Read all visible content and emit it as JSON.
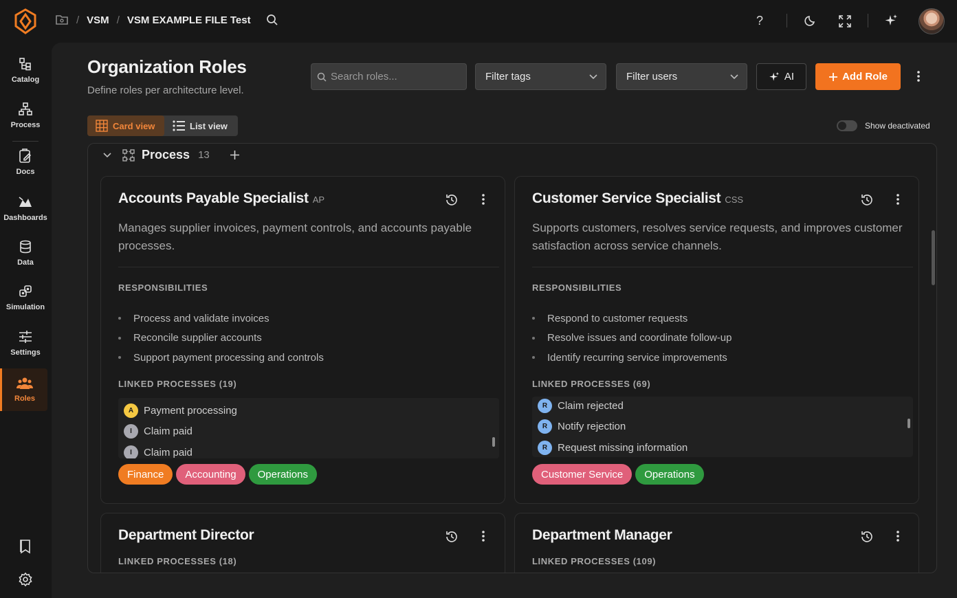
{
  "app": {
    "breadcrumb": [
      "VSM",
      "VSM EXAMPLE FILE Test"
    ],
    "help_label": "?"
  },
  "sidebar": {
    "items": [
      {
        "label": "Catalog",
        "icon": "catalog-icon"
      },
      {
        "label": "Process",
        "icon": "process-icon"
      },
      {
        "label": "Docs",
        "icon": "docs-icon"
      },
      {
        "label": "Dashboards",
        "icon": "dashboards-icon"
      },
      {
        "label": "Data",
        "icon": "database-icon"
      },
      {
        "label": "Simulation",
        "icon": "simulation-icon"
      },
      {
        "label": "Settings",
        "icon": "sliders-icon"
      },
      {
        "label": "Roles",
        "icon": "users-icon",
        "active": true
      }
    ]
  },
  "page": {
    "title": "Organization Roles",
    "subtitle": "Define roles per architecture level.",
    "search_placeholder": "Search roles...",
    "filter_tags": "Filter tags",
    "filter_users": "Filter users",
    "ai_label": "AI",
    "add_role_label": "Add Role",
    "card_view_label": "Card view",
    "list_view_label": "List view",
    "show_deactivated_label": "Show deactivated",
    "show_deactivated": false
  },
  "group": {
    "title": "Process",
    "count": "13"
  },
  "sections": {
    "responsibilities": "RESPONSIBILITIES"
  },
  "cards": [
    {
      "title": "Accounts Payable Specialist",
      "abbr": "AP",
      "description": "Manages supplier invoices, payment controls, and accounts payable processes.",
      "responsibilities": [
        "Process and validate invoices",
        "Reconcile supplier accounts",
        "Support payment processing and controls"
      ],
      "linked_label": "LINKED PROCESSES (19)",
      "linked": [
        {
          "badge": "A",
          "name": "Payment processing"
        },
        {
          "badge": "I",
          "name": "Claim paid"
        },
        {
          "badge": "I",
          "name": "Claim paid"
        }
      ],
      "tags": [
        {
          "label": "Finance",
          "color": "#f07c22"
        },
        {
          "label": "Accounting",
          "color": "#e0607a"
        },
        {
          "label": "Operations",
          "color": "#2f9a3f"
        }
      ]
    },
    {
      "title": "Customer Service Specialist",
      "abbr": "CSS",
      "description": "Supports customers, resolves service requests, and improves customer satisfaction across service channels.",
      "responsibilities": [
        "Respond to customer requests",
        "Resolve issues and coordinate follow-up",
        "Identify recurring service improvements"
      ],
      "linked_label": "LINKED PROCESSES (69)",
      "linked": [
        {
          "badge": "R",
          "name": "Claim rejected"
        },
        {
          "badge": "R",
          "name": "Notify rejection"
        },
        {
          "badge": "R",
          "name": "Request missing information"
        }
      ],
      "tags": [
        {
          "label": "Customer Service",
          "color": "#e0607a"
        },
        {
          "label": "Operations",
          "color": "#2f9a3f"
        }
      ]
    },
    {
      "title": "Department Director",
      "linked_label": "LINKED PROCESSES (18)"
    },
    {
      "title": "Department Manager",
      "linked_label": "LINKED PROCESSES (109)"
    }
  ],
  "colors": {
    "accent": "#f2731f",
    "badge_A": "#f5c842",
    "badge_I": "#a8a8b0",
    "badge_R": "#7fb3f0"
  }
}
